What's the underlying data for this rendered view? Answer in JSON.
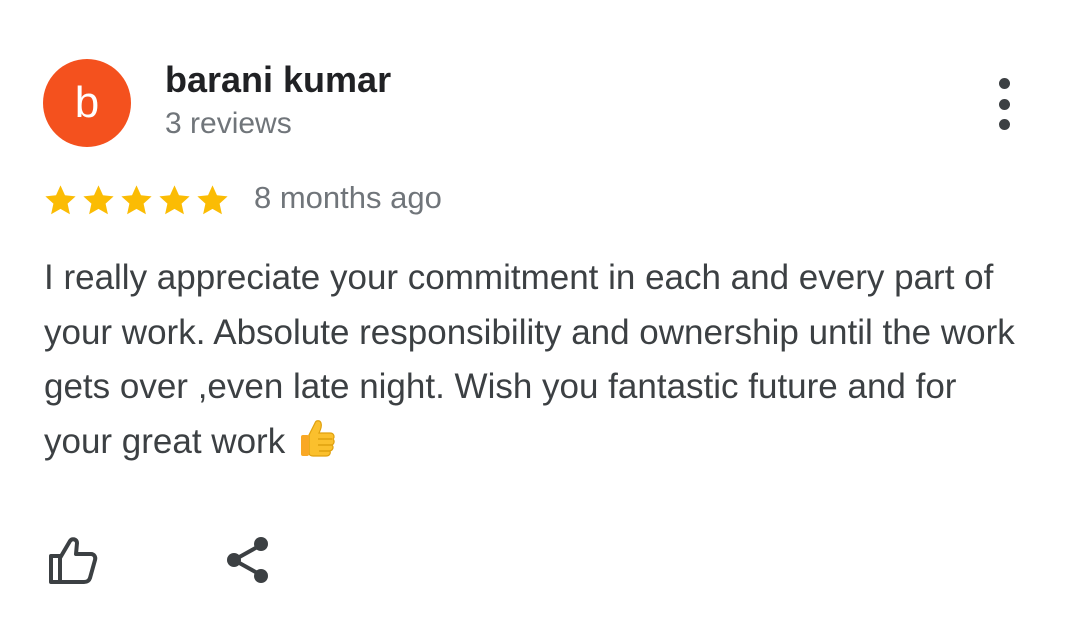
{
  "reviewer": {
    "initial": "b",
    "name": "barani kumar",
    "reviews_count": "3 reviews",
    "avatar_color": "#f4511e"
  },
  "rating": {
    "stars": 5,
    "max": 5,
    "star_color": "#fbbc04"
  },
  "timestamp": "8 months ago",
  "review": {
    "text": "I really appreciate your commitment in each and every part of your work. Absolute responsibility and ownership until the work gets over ,even late night. Wish you fantastic future and for your great work",
    "emoji": "thumbs-up-emoji"
  },
  "icons": {
    "more": "more-vert-icon",
    "like": "thumb-up-outline-icon",
    "share": "share-icon"
  }
}
